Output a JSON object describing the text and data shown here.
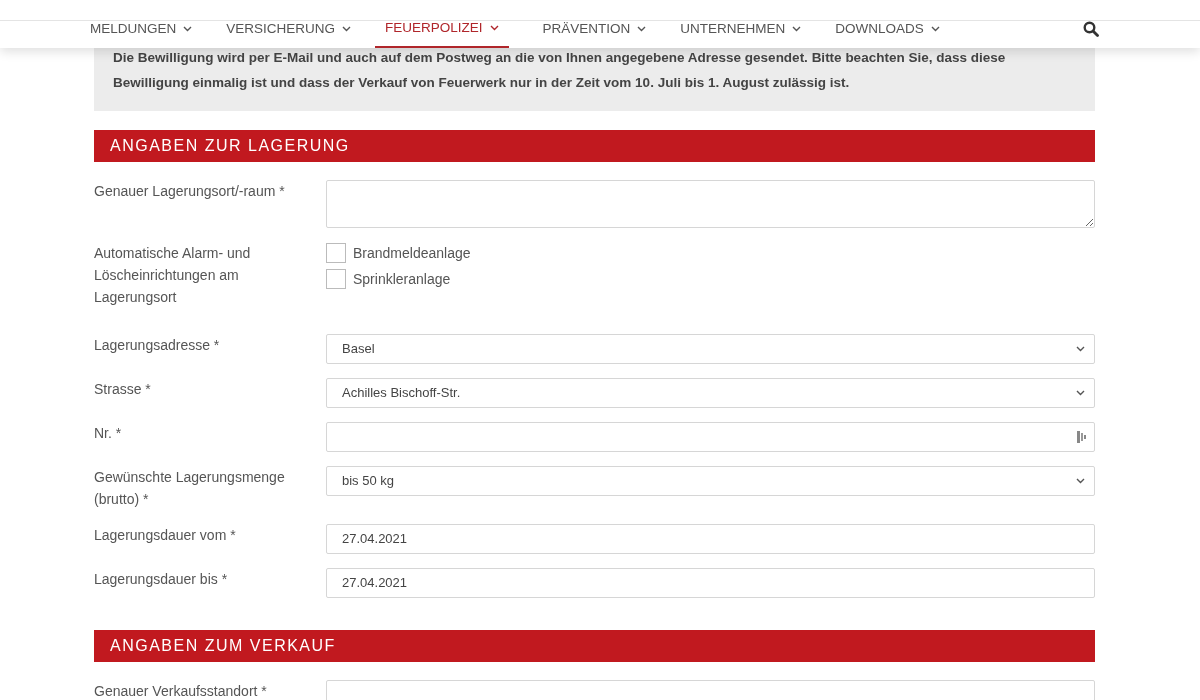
{
  "nav": {
    "items": [
      {
        "label": "MELDUNGEN",
        "selected": false
      },
      {
        "label": "VERSICHERUNG",
        "selected": false
      },
      {
        "label": "FEUERPOLIZEI",
        "selected": true
      },
      {
        "label": "PRÄVENTION",
        "selected": false
      },
      {
        "label": "UNTERNEHMEN",
        "selected": false
      },
      {
        "label": "DOWNLOADS",
        "selected": false
      }
    ]
  },
  "notice": {
    "lines": [
      "Die Bewilligung wird per E-Mail und auch auf dem Postweg an die von Ihnen angegebene Adresse gesendet. Bitte beachten Sie, dass diese",
      "Bewilligung einmalig ist und dass der Verkauf von Feuerwerk nur in der Zeit vom 10. Juli bis 1. August zulässig ist."
    ]
  },
  "sections": [
    {
      "title": "ANGABEN ZUR LAGERUNG",
      "fields": [
        {
          "kind": "textarea",
          "label": "Genauer Lagerungsort/-raum *"
        },
        {
          "kind": "checkboxes",
          "label": "Automatische Alarm- und Löscheinrichtungen am Lagerungsort",
          "options": [
            {
              "label": "Brandmeldeanlage",
              "checked": false
            },
            {
              "label": "Sprinkleranlage",
              "checked": false
            }
          ]
        },
        {
          "kind": "select",
          "label": "Lagerungsadresse *",
          "value": "Basel"
        },
        {
          "kind": "select",
          "label": "Strasse *",
          "value": "Achilles Bischoff-Str."
        },
        {
          "kind": "text",
          "label": "Nr. *"
        },
        {
          "kind": "select",
          "label": "Gewünschte Lagerungsmenge (brutto) *",
          "value": "bis 50 kg"
        },
        {
          "kind": "date",
          "label": "Lagerungsdauer vom *",
          "value": "27.04.2021"
        },
        {
          "kind": "date",
          "label": "Lagerungsdauer bis *",
          "value": "27.04.2021"
        }
      ]
    },
    {
      "title": "ANGABEN ZUM VERKAUF",
      "fields": [
        {
          "kind": "textarea",
          "label": "Genauer Verkaufsstandort *"
        }
      ]
    }
  ]
}
